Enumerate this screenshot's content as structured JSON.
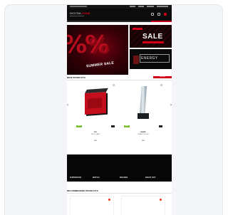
{
  "header": {
    "logo_primary": "DIGITAL",
    "logo_accent": "ZONE"
  },
  "hero": {
    "symbols": "%%",
    "symbols_back": "%",
    "label": "SUMMER SALE"
  },
  "promos": [
    {
      "label": "SALE"
    },
    {
      "label": "ENERGY"
    }
  ],
  "new_products": {
    "title": "NEW PRODUCTS",
    "button": "VIEW ALL",
    "items": [
      {
        "brand": "XPG",
        "name": "ELITE CASE",
        "price": "$00",
        "badge": "NEW"
      },
      {
        "brand": "AWARD",
        "name": "GLASS TROPHY",
        "price": "$00",
        "badge": "NEW"
      }
    ]
  },
  "banner": {
    "captions": [
      "SUPERSTAR",
      "WATCH",
      "BOLDEN",
      "NIGHT OUT"
    ]
  },
  "recommended": {
    "title": "RECOMMENDED PRODUCTS"
  },
  "colors": {
    "accent": "#d4001a",
    "dark": "#0c0c0c",
    "badge": "#7bbf2e"
  },
  "icons": [
    "user-icon",
    "cart-icon",
    "search-icon",
    "chevron-left-icon",
    "chevron-right-icon",
    "heart-icon"
  ]
}
